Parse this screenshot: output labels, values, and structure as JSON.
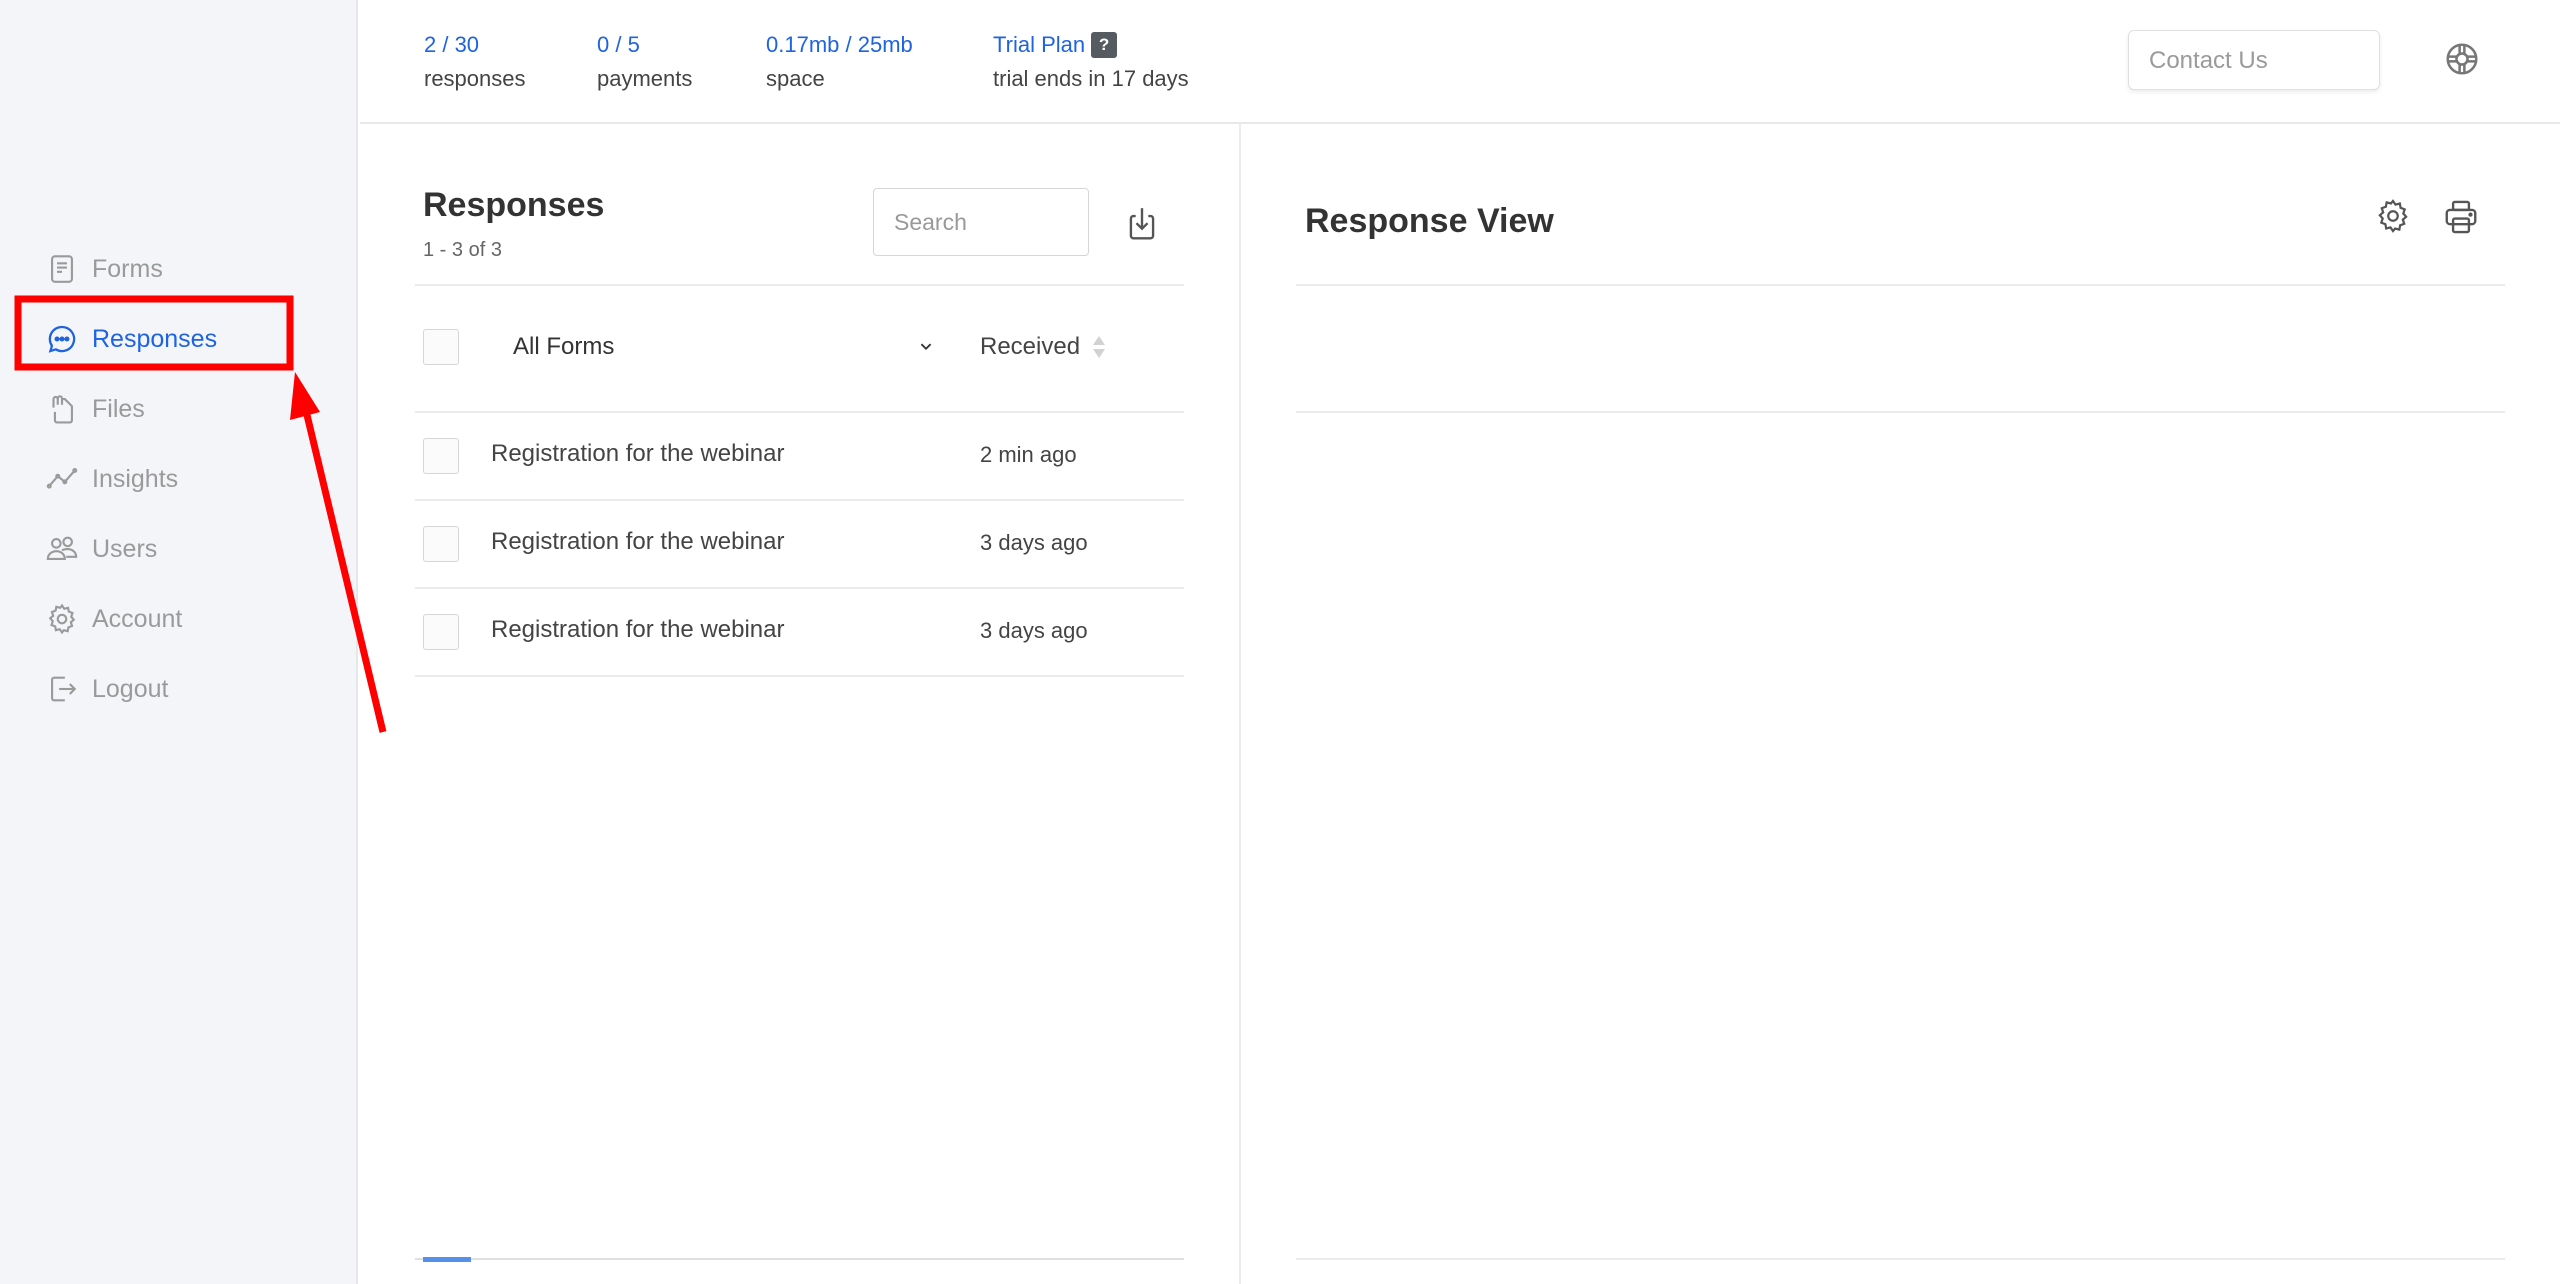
{
  "sidebar": {
    "items": [
      {
        "label": "Forms",
        "icon": "document-icon",
        "active": false
      },
      {
        "label": "Responses",
        "icon": "chat-bubble-icon",
        "active": true
      },
      {
        "label": "Files",
        "icon": "files-clip-icon",
        "active": false
      },
      {
        "label": "Insights",
        "icon": "line-chart-icon",
        "active": false
      },
      {
        "label": "Users",
        "icon": "users-icon",
        "active": false
      },
      {
        "label": "Account",
        "icon": "gear-icon",
        "active": false
      },
      {
        "label": "Logout",
        "icon": "logout-icon",
        "active": false
      }
    ]
  },
  "header": {
    "stats": [
      {
        "value": "2 / 30",
        "label": "responses"
      },
      {
        "value": "0 / 5",
        "label": "payments"
      },
      {
        "value": "0.17mb / 25mb",
        "label": "space"
      },
      {
        "value": "Trial Plan",
        "badge": "?",
        "label": "trial ends in 17 days"
      }
    ],
    "contact_label": "Contact Us",
    "help_icon": "lifebuoy-icon"
  },
  "list": {
    "title": "Responses",
    "count": "1 - 3 of 3",
    "search_placeholder": "Search",
    "search_value": "",
    "filter_label": "All Forms",
    "received_label": "Received",
    "rows": [
      {
        "name": "Registration for the webinar",
        "time": "2 min ago"
      },
      {
        "name": "Registration for the webinar",
        "time": "3 days ago"
      },
      {
        "name": "Registration for the webinar",
        "time": "3 days ago"
      }
    ],
    "scroll_progress": 0.0625
  },
  "detail": {
    "title": "Response View"
  },
  "colors": {
    "accent": "#1f63e0",
    "annotation": "#ff0000",
    "progress": "#5590ea"
  }
}
